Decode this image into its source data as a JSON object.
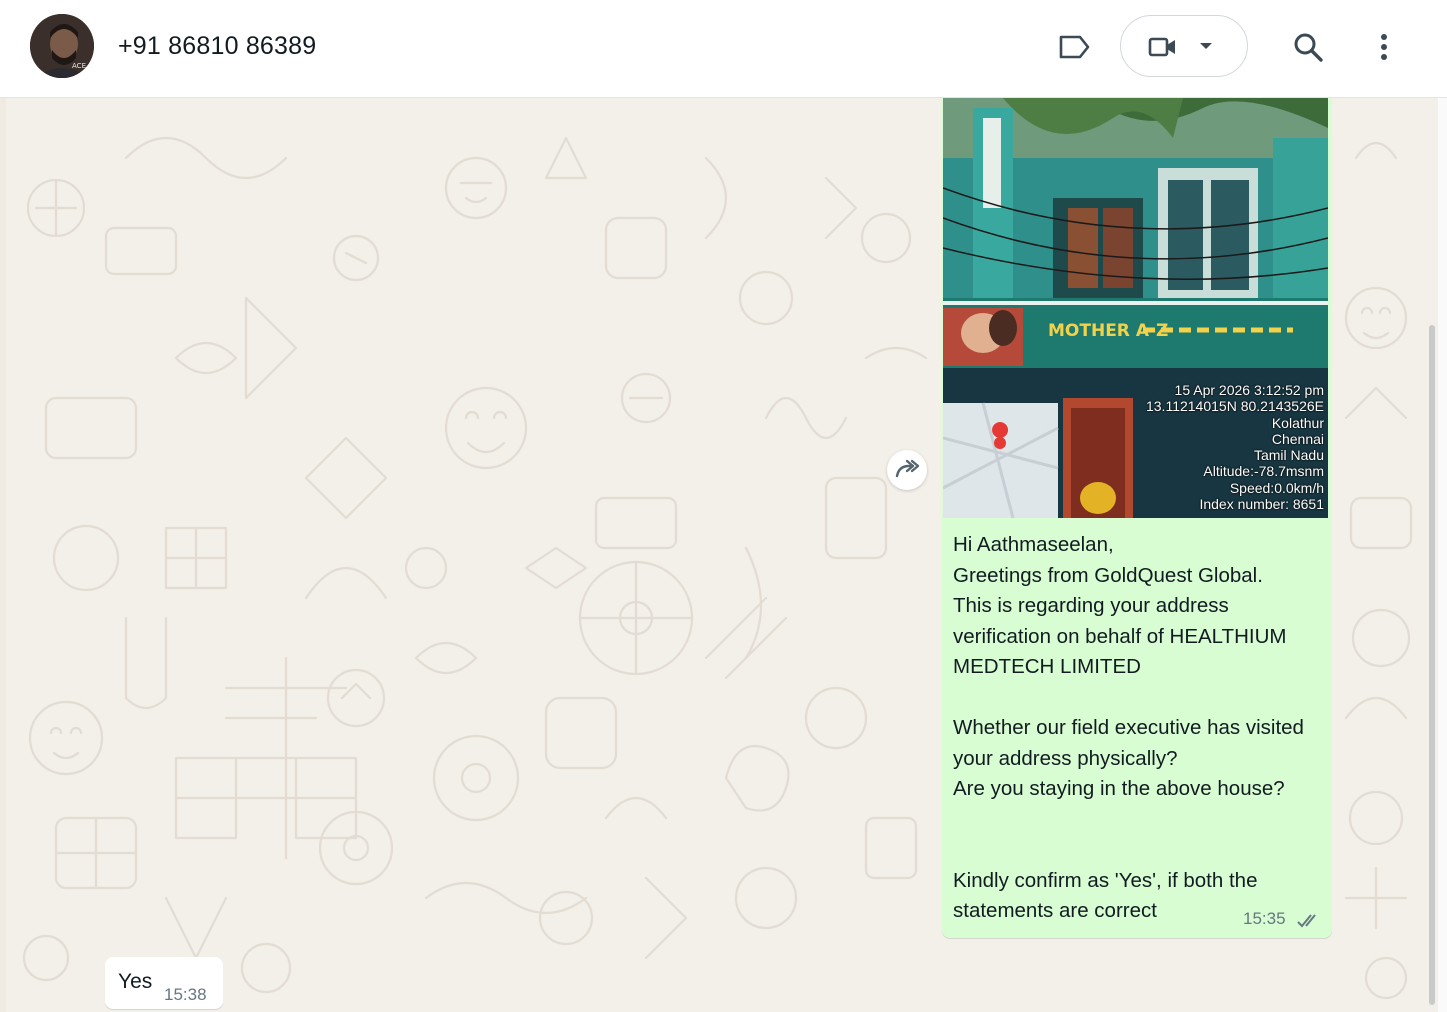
{
  "header": {
    "contact_name": "+91 86810 86389",
    "avatar_text": "ACE",
    "icons": {
      "label": "label-icon",
      "video": "video-camera-icon",
      "dropdown": "chevron-down-icon",
      "search": "search-icon",
      "menu": "more-vertical-icon"
    }
  },
  "photo": {
    "sign_text": "MOTHER A-Z",
    "stamp": {
      "datetime": "15 Apr 2026 3:12:52 pm",
      "coords": "13.11214015N 80.2143526E",
      "locality": "Kolathur",
      "city": "Chennai",
      "state": "Tamil Nadu",
      "altitude": "Altitude:-78.7msnm",
      "speed": "Speed:0.0km/h",
      "index": "Index number: 8651"
    }
  },
  "outgoing": {
    "text": "Hi Aathmaseelan,\nGreetings from GoldQuest Global.\nThis is regarding your address verification on behalf of HEALTHIUM MEDTECH LIMITED\n\nWhether our field executive has visited your address physically?\nAre you staying in the above house?\n\n\nKindly confirm as 'Yes', if both the statements are correct",
    "time": "15:35"
  },
  "incoming": {
    "text": "Yes",
    "time": "15:38"
  },
  "colors": {
    "outgoing_bubble": "#d9fdd3",
    "incoming_bubble": "#ffffff",
    "chat_bg": "#f3efe9",
    "tick_read": "#667781"
  }
}
